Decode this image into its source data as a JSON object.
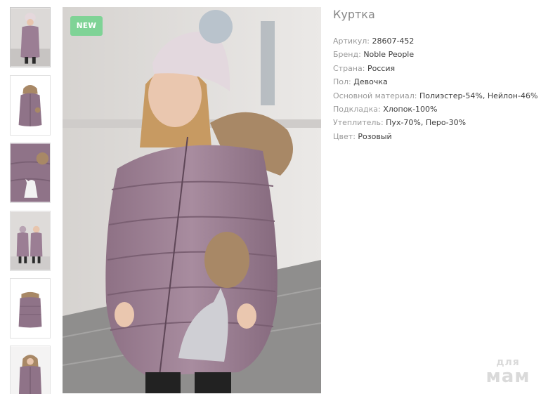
{
  "product": {
    "title": "Куртка",
    "badge": "NEW",
    "properties": [
      {
        "label": "Артикул:",
        "value": "28607-452"
      },
      {
        "label": "Бренд:",
        "value": "Noble People"
      },
      {
        "label": "Страна:",
        "value": "Россия"
      },
      {
        "label": "Пол:",
        "value": "Девочка"
      },
      {
        "label": "Основной материал:",
        "value": "Полиэстер-54%, Нейлон-46%"
      },
      {
        "label": "Подкладка:",
        "value": "Хлопок-100%"
      },
      {
        "label": "Утеплитель:",
        "value": "Пух-70%, Перо-30%"
      },
      {
        "label": "Цвет:",
        "value": "Розовый"
      }
    ]
  },
  "watermark": {
    "top": "для",
    "bottom": "мам"
  },
  "colors": {
    "badge": "#7fd396",
    "jacket": "#9b7e94",
    "fur": "#a88866"
  }
}
